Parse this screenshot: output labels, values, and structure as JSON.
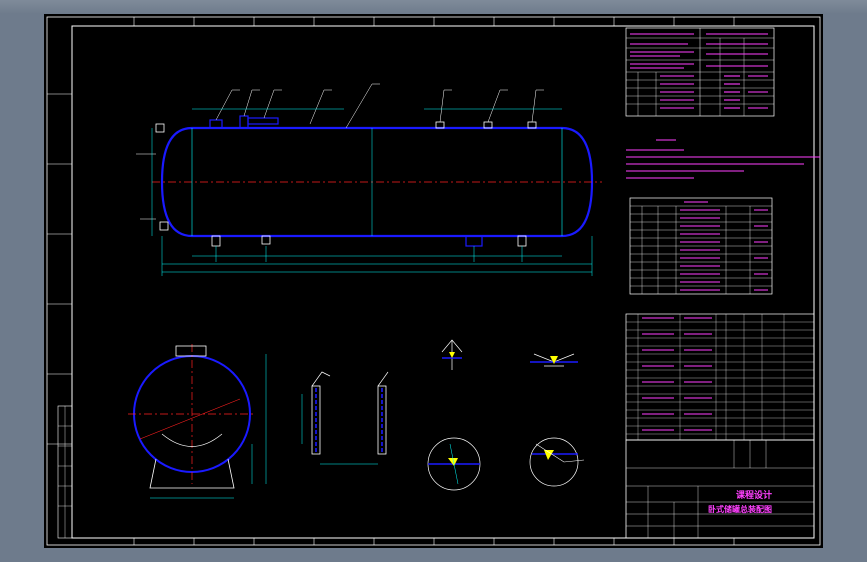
{
  "title_block": {
    "design_label": "课程设计",
    "drawing_title": "卧式储罐总装配图"
  },
  "colors": {
    "background": "#000000",
    "frame": "#ffffff",
    "vessel": "#1a1aff",
    "centerline": "#ff2020",
    "dimension": "#00ffff",
    "text": "#ff40ff",
    "weld": "#ffff00"
  }
}
